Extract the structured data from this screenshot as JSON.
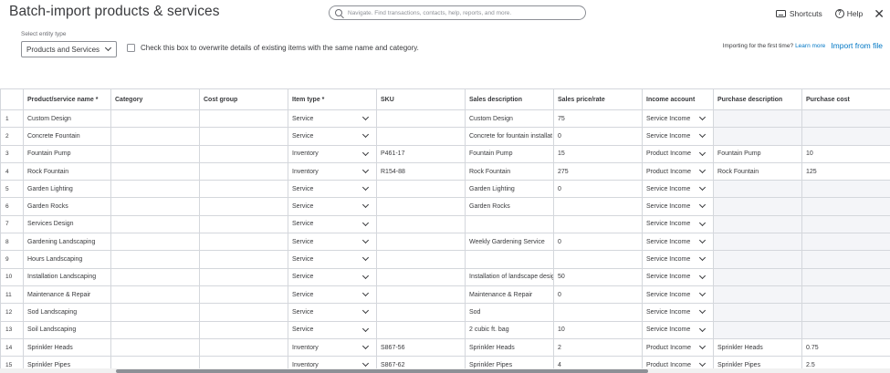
{
  "page": {
    "title": "Batch-import products & services"
  },
  "search": {
    "placeholder": "Navigate. Find transactions, contacts, help, reports, and more."
  },
  "header": {
    "shortcuts": "Shortcuts",
    "help": "Help",
    "close": "✕"
  },
  "entity": {
    "label": "Select entity type",
    "value": "Products and Services"
  },
  "overwrite": {
    "label": "Check this box to overwrite details of existing items with the same name and category."
  },
  "importing": {
    "first_time": "Importing for the first time?",
    "learn_more": "Learn more",
    "import_file": "Import from file"
  },
  "table": {
    "headers": [
      "",
      "Product/service name *",
      "Category",
      "Cost group",
      "Item type *",
      "SKU",
      "Sales description",
      "Sales price/rate",
      "Income account",
      "Purchase description",
      "Purchase cost"
    ],
    "rows": [
      {
        "num": "1",
        "name": "Custom Design",
        "category": "",
        "cost_group": "",
        "type": "Service",
        "sku": "",
        "sales_desc": "Custom Design",
        "price": "75",
        "income": "Service Income",
        "purch_desc": "",
        "purch_cost": "",
        "gray": true
      },
      {
        "num": "2",
        "name": "Concrete Fountain",
        "category": "",
        "cost_group": "",
        "type": "Service",
        "sku": "",
        "sales_desc": "Concrete for fountain installat",
        "price": "0",
        "income": "Service Income",
        "purch_desc": "",
        "purch_cost": "",
        "gray": true
      },
      {
        "num": "3",
        "name": "Fountain Pump",
        "category": "",
        "cost_group": "",
        "type": "Inventory",
        "sku": "P461-17",
        "sales_desc": "Fountain Pump",
        "price": "15",
        "income": "Product Income",
        "purch_desc": "Fountain Pump",
        "purch_cost": "10",
        "gray": false
      },
      {
        "num": "4",
        "name": "Rock Fountain",
        "category": "",
        "cost_group": "",
        "type": "Inventory",
        "sku": "R154-88",
        "sales_desc": "Rock Fountain",
        "price": "275",
        "income": "Product Income",
        "purch_desc": "Rock Fountain",
        "purch_cost": "125",
        "gray": false
      },
      {
        "num": "5",
        "name": "Garden Lighting",
        "category": "",
        "cost_group": "",
        "type": "Service",
        "sku": "",
        "sales_desc": "Garden Lighting",
        "price": "0",
        "income": "Service Income",
        "purch_desc": "",
        "purch_cost": "",
        "gray": true
      },
      {
        "num": "6",
        "name": "Garden Rocks",
        "category": "",
        "cost_group": "",
        "type": "Service",
        "sku": "",
        "sales_desc": "Garden Rocks",
        "price": "",
        "income": "Service Income",
        "purch_desc": "",
        "purch_cost": "",
        "gray": true
      },
      {
        "num": "7",
        "name": "Services Design",
        "category": "",
        "cost_group": "",
        "type": "Service",
        "sku": "",
        "sales_desc": "",
        "price": "",
        "income": "Service Income",
        "purch_desc": "",
        "purch_cost": "",
        "gray": true
      },
      {
        "num": "8",
        "name": "Gardening Landscaping",
        "category": "",
        "cost_group": "",
        "type": "Service",
        "sku": "",
        "sales_desc": "Weekly Gardening Service",
        "price": "0",
        "income": "Service Income",
        "purch_desc": "",
        "purch_cost": "",
        "gray": true
      },
      {
        "num": "9",
        "name": "Hours Landscaping",
        "category": "",
        "cost_group": "",
        "type": "Service",
        "sku": "",
        "sales_desc": "",
        "price": "",
        "income": "Service Income",
        "purch_desc": "",
        "purch_cost": "",
        "gray": true
      },
      {
        "num": "10",
        "name": "Installation Landscaping",
        "category": "",
        "cost_group": "",
        "type": "Service",
        "sku": "",
        "sales_desc": "Installation of landscape desig",
        "price": "50",
        "income": "Service Income",
        "purch_desc": "",
        "purch_cost": "",
        "gray": true
      },
      {
        "num": "11",
        "name": "Maintenance & Repair",
        "category": "",
        "cost_group": "",
        "type": "Service",
        "sku": "",
        "sales_desc": "Maintenance & Repair",
        "price": "0",
        "income": "Service Income",
        "purch_desc": "",
        "purch_cost": "",
        "gray": true
      },
      {
        "num": "12",
        "name": "Sod Landscaping",
        "category": "",
        "cost_group": "",
        "type": "Service",
        "sku": "",
        "sales_desc": "Sod",
        "price": "",
        "income": "Service Income",
        "purch_desc": "",
        "purch_cost": "",
        "gray": true
      },
      {
        "num": "13",
        "name": "Soil Landscaping",
        "category": "",
        "cost_group": "",
        "type": "Service",
        "sku": "",
        "sales_desc": "2 cubic ft. bag",
        "price": "10",
        "income": "Service Income",
        "purch_desc": "",
        "purch_cost": "",
        "gray": true
      },
      {
        "num": "14",
        "name": "Sprinkler Heads",
        "category": "",
        "cost_group": "",
        "type": "Inventory",
        "sku": "S867-56",
        "sales_desc": "Sprinkler Heads",
        "price": "2",
        "income": "Product Income",
        "purch_desc": "Sprinkler Heads",
        "purch_cost": "0.75",
        "gray": false
      },
      {
        "num": "15",
        "name": "Sprinkler Pipes",
        "category": "",
        "cost_group": "",
        "type": "Inventory",
        "sku": "S867-62",
        "sales_desc": "Sprinkler Pipes",
        "price": "4",
        "income": "Product Income",
        "purch_desc": "Sprinkler Pipes",
        "purch_cost": "2.5",
        "gray": false
      }
    ]
  },
  "colors": {
    "link": "#0077c5",
    "text": "#393a3d",
    "border": "#d4d7dc",
    "disabled_cell": "#f4f5f8"
  }
}
